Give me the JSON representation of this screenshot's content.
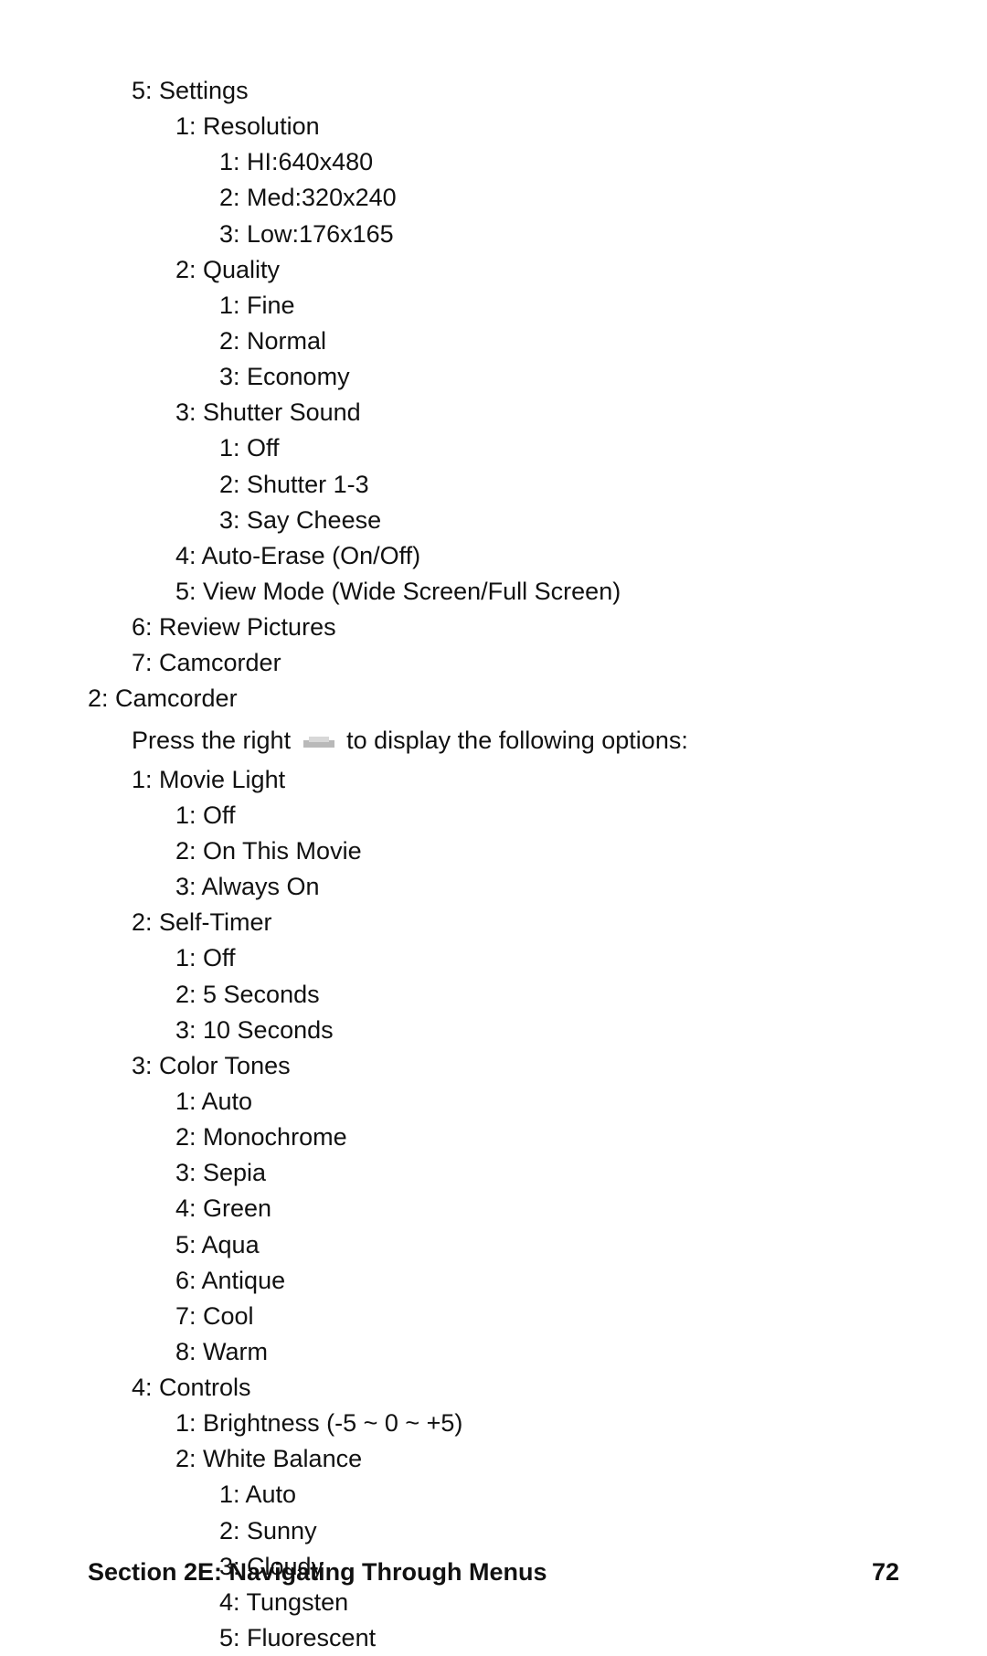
{
  "top": {
    "settings": {
      "label": "5: Settings",
      "resolution": {
        "label": "1: Resolution",
        "i1": "1: HI:640x480",
        "i2": "2: Med:320x240",
        "i3": "3: Low:176x165"
      },
      "quality": {
        "label": "2: Quality",
        "i1": "1: Fine",
        "i2": "2: Normal",
        "i3": "3: Economy"
      },
      "shutter": {
        "label": "3: Shutter Sound",
        "i1": "1: Off",
        "i2": "2: Shutter 1-3",
        "i3": "3: Say Cheese"
      },
      "autoErase": "4: Auto-Erase (On/Off)",
      "viewMode": "5: View Mode (Wide Screen/Full Screen)"
    },
    "review": "6: Review Pictures",
    "camcorder": "7: Camcorder"
  },
  "camHeader": "2: Camcorder",
  "para": {
    "pre": "Press the right",
    "post": "to display the following options:"
  },
  "cam": {
    "movieLight": {
      "label": "1: Movie Light",
      "i1": "1: Off",
      "i2": "2: On This Movie",
      "i3": "3: Always On"
    },
    "selfTimer": {
      "label": "2: Self-Timer",
      "i1": "1: Off",
      "i2": "2: 5 Seconds",
      "i3": "3: 10 Seconds"
    },
    "colorTones": {
      "label": "3: Color Tones",
      "i1": "1: Auto",
      "i2": "2: Monochrome",
      "i3": "3: Sepia",
      "i4": "4: Green",
      "i5": "5: Aqua",
      "i6": "6: Antique",
      "i7": "7: Cool",
      "i8": "8: Warm"
    },
    "controls": {
      "label": "4: Controls",
      "brightness": "1: Brightness (-5 ~ 0 ~ +5)",
      "whiteBalance": {
        "label": "2: White Balance",
        "i1": "1: Auto",
        "i2": "2: Sunny",
        "i3": "3: Cloudy",
        "i4": "4: Tungsten",
        "i5": "5: Fluorescent"
      }
    }
  },
  "footer": {
    "section": "Section 2E: Navigating Through Menus",
    "page": "72"
  }
}
